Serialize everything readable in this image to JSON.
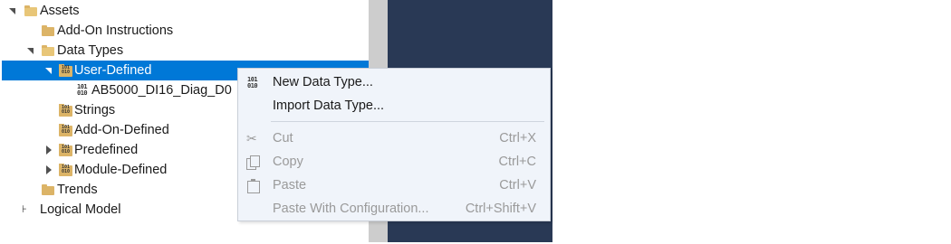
{
  "tree": {
    "assets": "Assets",
    "add_on_instructions": "Add-On Instructions",
    "data_types": "Data Types",
    "user_defined": "User-Defined",
    "ab5000": "AB5000_DI16_Diag_D0",
    "strings": "Strings",
    "add_on_defined": "Add-On-Defined",
    "predefined": "Predefined",
    "module_defined": "Module-Defined",
    "trends": "Trends",
    "logical_model": "Logical Model",
    "binary_glyph_top": "101",
    "binary_glyph_bottom": "010"
  },
  "context_menu": {
    "new_data_type": "New Data Type...",
    "import_data_type": "Import Data Type...",
    "cut": "Cut",
    "cut_shortcut": "Ctrl+X",
    "copy": "Copy",
    "copy_shortcut": "Ctrl+C",
    "paste": "Paste",
    "paste_shortcut": "Ctrl+V",
    "paste_with_config": "Paste With Configuration...",
    "paste_with_config_shortcut": "Ctrl+Shift+V"
  },
  "colors": {
    "selection": "#0078d7",
    "dark_pane": "#293955",
    "scrollbar": "#cdcdcd",
    "menu_bg": "#f0f4fa",
    "folder": "#dcb467",
    "disabled_text": "#9a9a9a"
  }
}
